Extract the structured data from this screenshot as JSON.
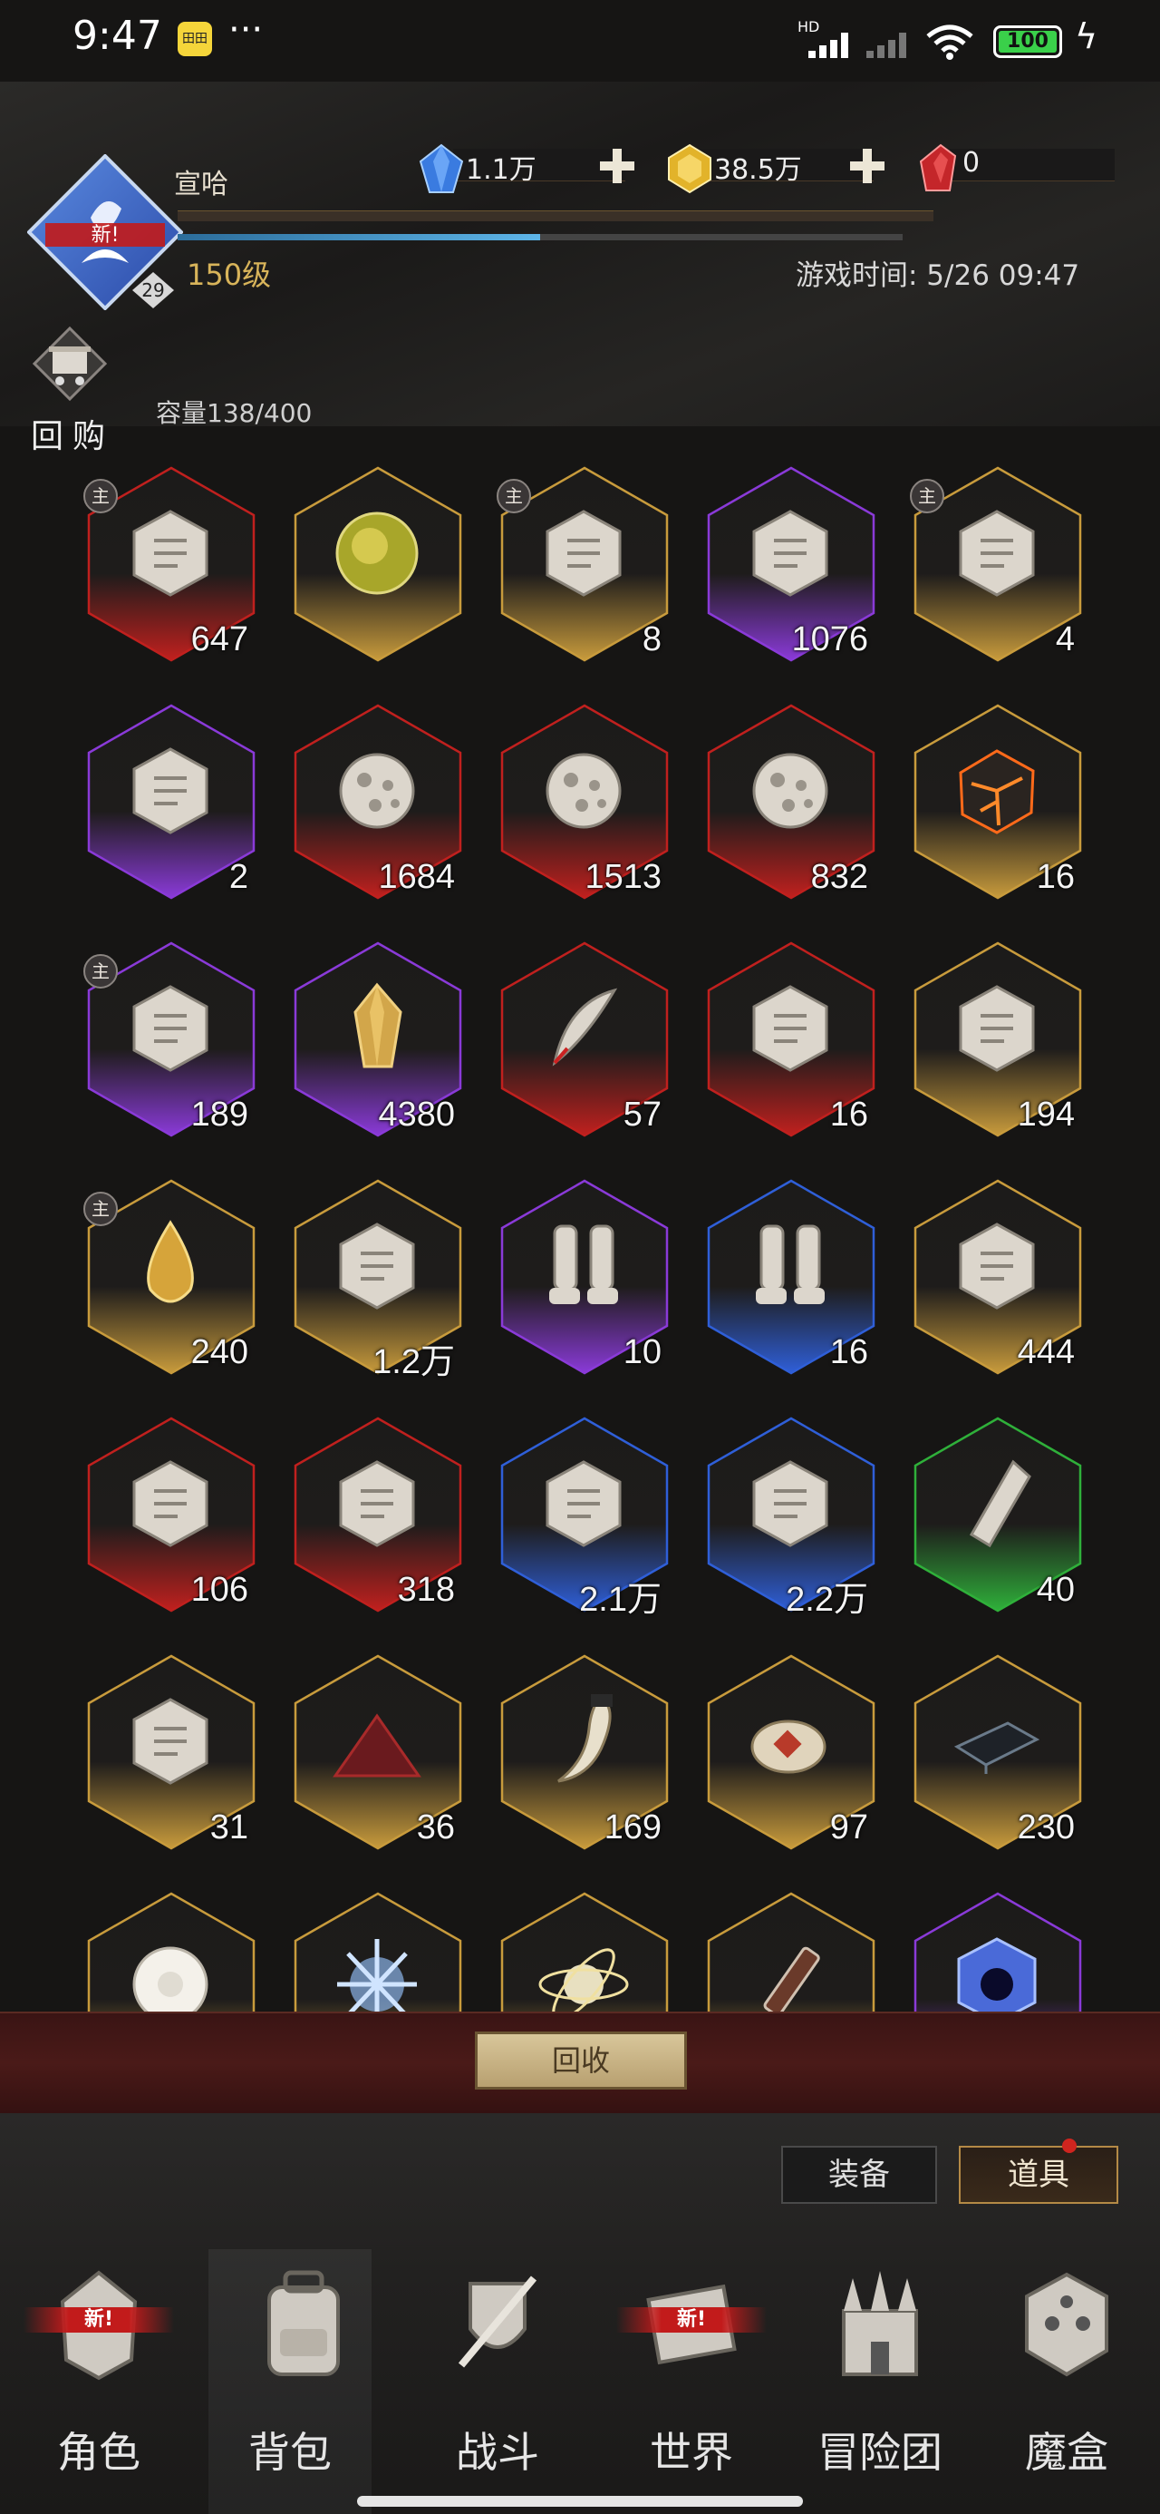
{
  "status_bar": {
    "time": "9:47",
    "app_icon_label": "田田",
    "more": "···",
    "signal_label": "HD",
    "battery": "100"
  },
  "player": {
    "name": "宣哈",
    "level": "150级",
    "badge_level": "29",
    "avatar_new": "新!",
    "exp_fraction": 0.5,
    "game_time": "游戏时间: 5/26 09:47"
  },
  "currencies": [
    {
      "name": "crystal",
      "value": "1.1万",
      "color": "#3a7be0"
    },
    {
      "name": "gold",
      "value": "38.5万",
      "color": "#e2b32a"
    },
    {
      "name": "ruby",
      "value": "0",
      "color": "#c4262a"
    }
  ],
  "buyback": {
    "label": "回购"
  },
  "capacity": "容量138/400",
  "items": [
    {
      "icon": "scroll-fragment-icon",
      "count": "647",
      "rarity": "red",
      "main": true
    },
    {
      "icon": "amber-orb-icon",
      "count": "",
      "rarity": "gold",
      "main": false
    },
    {
      "icon": "stone-tablet-icon",
      "count": "8",
      "rarity": "gold",
      "main": true
    },
    {
      "icon": "crystal-shard-icon",
      "count": "1076",
      "rarity": "purple",
      "main": false
    },
    {
      "icon": "rune-tablet-icon",
      "count": "4",
      "rarity": "gold",
      "main": true
    },
    {
      "icon": "spirit-flame-icon",
      "count": "2",
      "rarity": "purple",
      "main": false
    },
    {
      "icon": "moon-rock-icon",
      "count": "1684",
      "rarity": "red",
      "main": false
    },
    {
      "icon": "moon-rock-icon",
      "count": "1513",
      "rarity": "red",
      "main": false
    },
    {
      "icon": "moon-rock-icon",
      "count": "832",
      "rarity": "red",
      "main": false
    },
    {
      "icon": "lava-rock-icon",
      "count": "16",
      "rarity": "gold",
      "main": false
    },
    {
      "icon": "dust-pile-icon",
      "count": "189",
      "rarity": "purple",
      "main": true
    },
    {
      "icon": "gold-crystal-icon",
      "count": "4380",
      "rarity": "purple",
      "main": false
    },
    {
      "icon": "quill-feather-icon",
      "count": "57",
      "rarity": "red",
      "main": false
    },
    {
      "icon": "eye-pyramid-icon",
      "count": "16",
      "rarity": "red",
      "main": false
    },
    {
      "icon": "sand-pile-icon",
      "count": "194",
      "rarity": "gold",
      "main": false
    },
    {
      "icon": "golden-drop-icon",
      "count": "240",
      "rarity": "gold",
      "main": true
    },
    {
      "icon": "seed-pod-icon",
      "count": "1.2万",
      "rarity": "gold",
      "main": false
    },
    {
      "icon": "greaves-icon",
      "count": "10",
      "rarity": "purple",
      "main": false
    },
    {
      "icon": "greaves-icon",
      "count": "16",
      "rarity": "blue",
      "main": false
    },
    {
      "icon": "star-map-icon",
      "count": "444",
      "rarity": "gold",
      "main": false
    },
    {
      "icon": "sextant-icon",
      "count": "106",
      "rarity": "red",
      "main": false
    },
    {
      "icon": "parchment-icon",
      "count": "318",
      "rarity": "red",
      "main": false
    },
    {
      "icon": "winged-sword-emblem-icon",
      "count": "2.1万",
      "rarity": "blue",
      "main": false
    },
    {
      "icon": "hammer-medal-icon",
      "count": "2.2万",
      "rarity": "blue",
      "main": false
    },
    {
      "icon": "bone-fragment-icon",
      "count": "40",
      "rarity": "green",
      "main": false
    },
    {
      "icon": "crossed-tools-medal-icon",
      "count": "31",
      "rarity": "gold",
      "main": false
    },
    {
      "icon": "red-powder-icon",
      "count": "36",
      "rarity": "gold",
      "main": false
    },
    {
      "icon": "beast-fang-icon",
      "count": "169",
      "rarity": "gold",
      "main": false
    },
    {
      "icon": "pouch-icon",
      "count": "97",
      "rarity": "gold",
      "main": false
    },
    {
      "icon": "dark-book-icon",
      "count": "230",
      "rarity": "gold",
      "main": false
    },
    {
      "icon": "white-flower-icon",
      "count": "",
      "rarity": "gold",
      "main": false
    },
    {
      "icon": "frost-crystal-icon",
      "count": "",
      "rarity": "gold",
      "main": false
    },
    {
      "icon": "orbit-sphere-icon",
      "count": "",
      "rarity": "gold",
      "main": false
    },
    {
      "icon": "syringe-icon",
      "count": "",
      "rarity": "gold",
      "main": false
    },
    {
      "icon": "void-cube-icon",
      "count": "",
      "rarity": "purple",
      "main": false
    }
  ],
  "main_badge_label": "主",
  "recycle_label": "回收",
  "tabs": {
    "equipment": "装备",
    "items": "道具"
  },
  "nav": [
    {
      "label": "角色",
      "icon": "helmet-icon",
      "new": true,
      "active": false
    },
    {
      "label": "背包",
      "icon": "backpack-icon",
      "new": false,
      "active": true
    },
    {
      "label": "战斗",
      "icon": "shield-sword-icon",
      "new": false,
      "active": false
    },
    {
      "label": "世界",
      "icon": "map-scroll-icon",
      "new": true,
      "active": false
    },
    {
      "label": "冒险团",
      "icon": "castle-icon",
      "new": false,
      "active": false
    },
    {
      "label": "魔盒",
      "icon": "magic-cube-icon",
      "new": false,
      "active": false
    }
  ],
  "new_label": "新!",
  "rarity_colors": {
    "red": "#c0201e",
    "gold": "#c89b3c",
    "purple": "#8a3ad8",
    "blue": "#2f5fd8",
    "green": "#2fb03a"
  }
}
